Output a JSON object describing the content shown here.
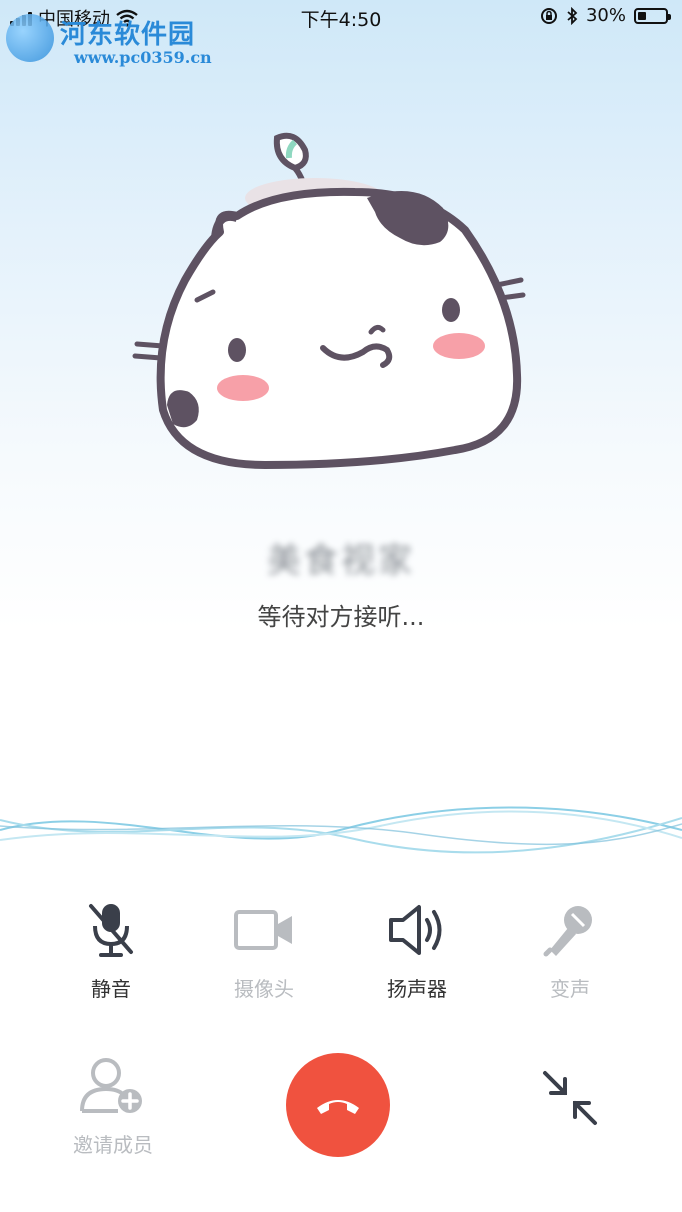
{
  "status_bar": {
    "carrier": "中国移动",
    "time": "下午4:50",
    "battery_percent": "30%",
    "battery_level": 0.3
  },
  "watermark": {
    "site_name": "河东软件园",
    "url": "www.pc0359.cn"
  },
  "call": {
    "caller_name": "美食视家",
    "status_text": "等待对方接听..."
  },
  "controls": [
    {
      "label": "静音",
      "icon": "mic-off-icon",
      "enabled": true
    },
    {
      "label": "摄像头",
      "icon": "camera-icon",
      "enabled": false
    },
    {
      "label": "扬声器",
      "icon": "speaker-icon",
      "enabled": true
    },
    {
      "label": "变声",
      "icon": "voice-changer-icon",
      "enabled": false
    }
  ],
  "bottom": {
    "invite_label": "邀请成员",
    "hangup_icon": "hangup-icon",
    "minimize_icon": "minimize-icon"
  },
  "colors": {
    "hangup": "#f0523f",
    "enabled_icon": "#3a3f4a",
    "disabled_icon": "#b9bcc0",
    "wave": "#7ec6e0"
  }
}
